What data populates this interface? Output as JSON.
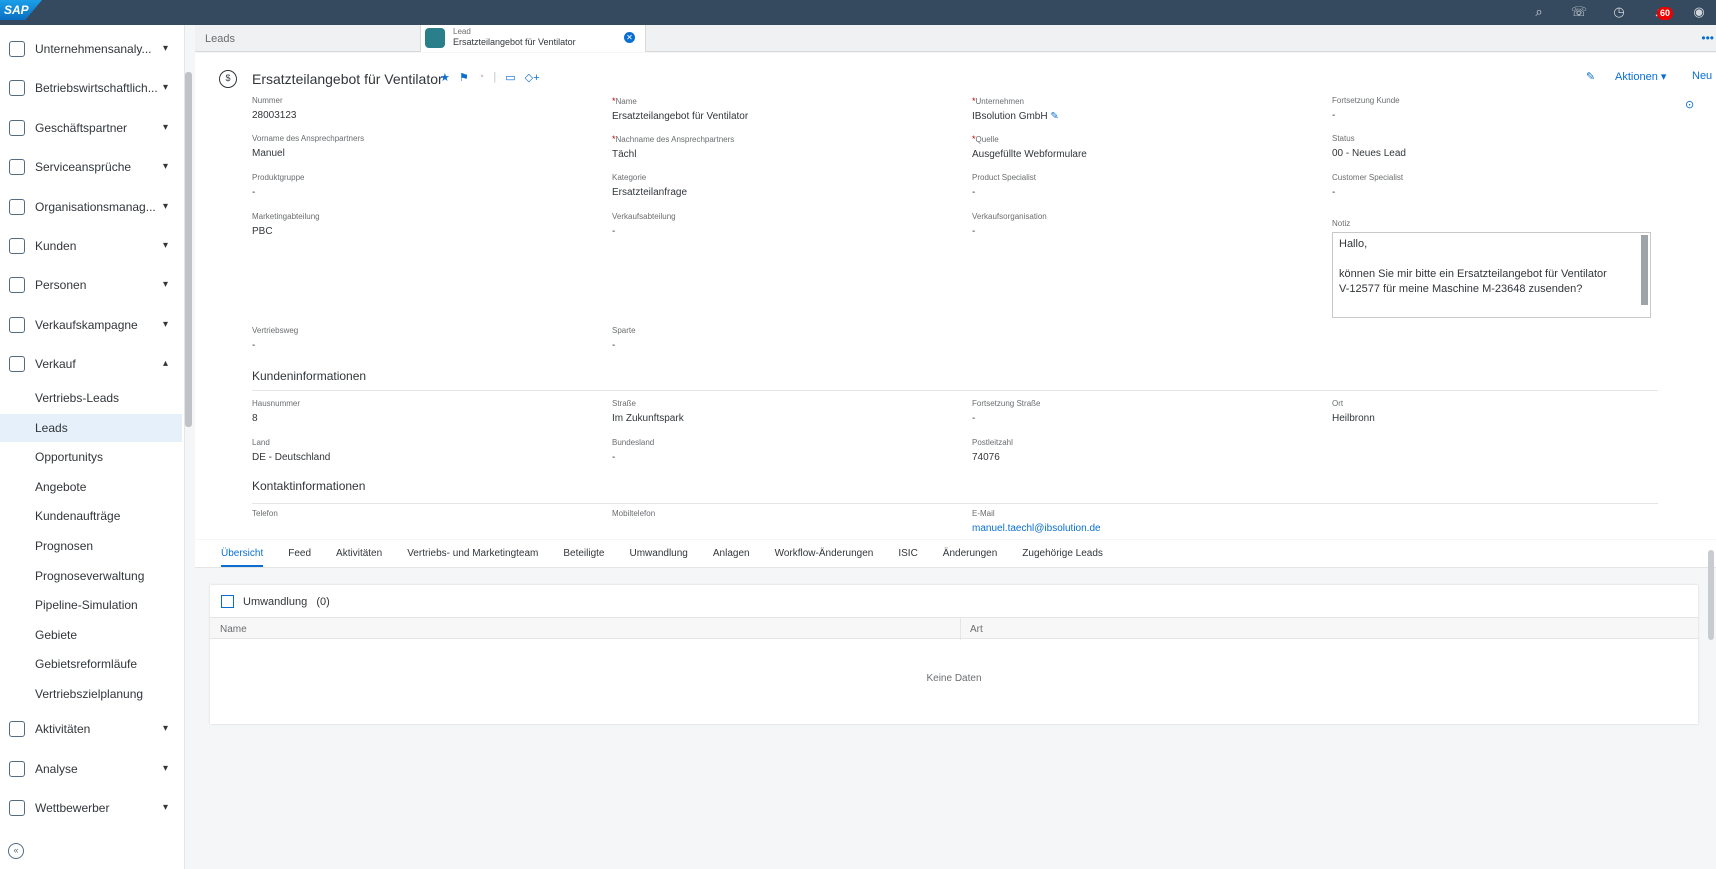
{
  "topbar": {
    "logo": "SAP",
    "icons": [
      "search-icon",
      "chat-icon",
      "clock-icon",
      "bell-icon",
      "user-icon"
    ],
    "notification_count": "60"
  },
  "sidebar": {
    "items": [
      {
        "label": "Unternehmensanaly...",
        "icon": "analytics-icon",
        "expanded": false
      },
      {
        "label": "Betriebswirtschaftlich...",
        "icon": "business-icon",
        "expanded": false
      },
      {
        "label": "Geschäftspartner",
        "icon": "partner-icon",
        "expanded": false
      },
      {
        "label": "Serviceansprüche",
        "icon": "service-icon",
        "expanded": false
      },
      {
        "label": "Organisationsmanag...",
        "icon": "org-icon",
        "expanded": false
      },
      {
        "label": "Kunden",
        "icon": "customers-icon",
        "expanded": false
      },
      {
        "label": "Personen",
        "icon": "person-icon",
        "expanded": false
      },
      {
        "label": "Verkaufskampagne",
        "icon": "campaign-icon",
        "expanded": false
      },
      {
        "label": "Verkauf",
        "icon": "sales-icon",
        "expanded": true
      }
    ],
    "sub_items": [
      "Vertriebs-Leads",
      "Leads",
      "Opportunitys",
      "Angebote",
      "Kundenaufträge",
      "Prognosen",
      "Prognoseverwaltung",
      "Pipeline-Simulation",
      "Gebiete",
      "Gebietsreformläufe",
      "Vertriebszielplanung"
    ],
    "active_sub": "Leads",
    "bottom_items": [
      {
        "label": "Aktivitäten",
        "icon": "activities-icon"
      },
      {
        "label": "Analyse",
        "icon": "analysis-icon"
      },
      {
        "label": "Wettbewerber",
        "icon": "competitor-icon"
      }
    ]
  },
  "tabbar": {
    "leads_tab": "Leads",
    "active_tab_sub": "Lead",
    "active_tab_title": "Ersatzteilangebot für Ventilator"
  },
  "header": {
    "title": "Ersatzteilangebot für Ventilator",
    "actions": {
      "edit_icon": "pencil-icon",
      "aktionen": "Aktionen",
      "neu": "Neu"
    },
    "fields": {
      "nummer": {
        "label": "Nummer",
        "value": "28003123"
      },
      "name": {
        "label": "Name",
        "value": "Ersatzteilangebot für Ventilator"
      },
      "unternehmen": {
        "label": "Unternehmen",
        "value": "IBsolution GmbH"
      },
      "fortsetzung_kunde": {
        "label": "Fortsetzung Kunde",
        "value": "-"
      },
      "vorname": {
        "label": "Vorname des Ansprechpartners",
        "value": "Manuel"
      },
      "nachname": {
        "label": "Nachname des Ansprechpartners",
        "value": "Tächl"
      },
      "quelle": {
        "label": "Quelle",
        "value": "Ausgefüllte Webformulare"
      },
      "status": {
        "label": "Status",
        "value": "00 - Neues Lead"
      },
      "produktgruppe": {
        "label": "Produktgruppe",
        "value": "-"
      },
      "kategorie": {
        "label": "Kategorie",
        "value": "Ersatzteilanfrage"
      },
      "product_specialist": {
        "label": "Product Specialist",
        "value": "-"
      },
      "customer_specialist": {
        "label": "Customer Specialist",
        "value": "-"
      },
      "marketingabteilung": {
        "label": "Marketingabteilung",
        "value": "PBC"
      },
      "verkaufsabteilung": {
        "label": "Verkaufsabteilung",
        "value": "-"
      },
      "verkaufsorganisation": {
        "label": "Verkaufsorganisation",
        "value": "-"
      },
      "notiz": {
        "label": "Notiz",
        "line1": "Hallo,",
        "line2": "können Sie mir bitte ein Ersatzteilangebot für Ventilator",
        "line3": "V-12577 für meine Maschine M-23648 zusenden?"
      },
      "vertriebsweg": {
        "label": "Vertriebsweg",
        "value": "-"
      },
      "sparte": {
        "label": "Sparte",
        "value": "-"
      }
    },
    "kunden_title": "Kundeninformationen",
    "kunden": {
      "hausnummer": {
        "label": "Hausnummer",
        "value": "8"
      },
      "strasse": {
        "label": "Straße",
        "value": "Im Zukunftspark"
      },
      "fortsetzung_strasse": {
        "label": "Fortsetzung Straße",
        "value": "-"
      },
      "ort": {
        "label": "Ort",
        "value": "Heilbronn"
      },
      "land": {
        "label": "Land",
        "value": "DE - Deutschland"
      },
      "bundesland": {
        "label": "Bundesland",
        "value": "-"
      },
      "postleitzahl": {
        "label": "Postleitzahl",
        "value": "74076"
      }
    },
    "kontakt_title": "Kontaktinformationen",
    "kontakt": {
      "telefon": {
        "label": "Telefon",
        "value": ""
      },
      "mobiltelefon": {
        "label": "Mobiltelefon",
        "value": ""
      },
      "email": {
        "label": "E-Mail",
        "value": "manuel.taechl@ibsolution.de"
      }
    }
  },
  "object_tabs": [
    "Übersicht",
    "Feed",
    "Aktivitäten",
    "Vertriebs- und Marketingteam",
    "Beteiligte",
    "Umwandlung",
    "Anlagen",
    "Workflow-Änderungen",
    "ISIC",
    "Änderungen",
    "Zugehörige Leads"
  ],
  "card": {
    "title": "Umwandlung",
    "count": "(0)",
    "col_name": "Name",
    "col_art": "Art",
    "empty": "Keine Daten"
  }
}
